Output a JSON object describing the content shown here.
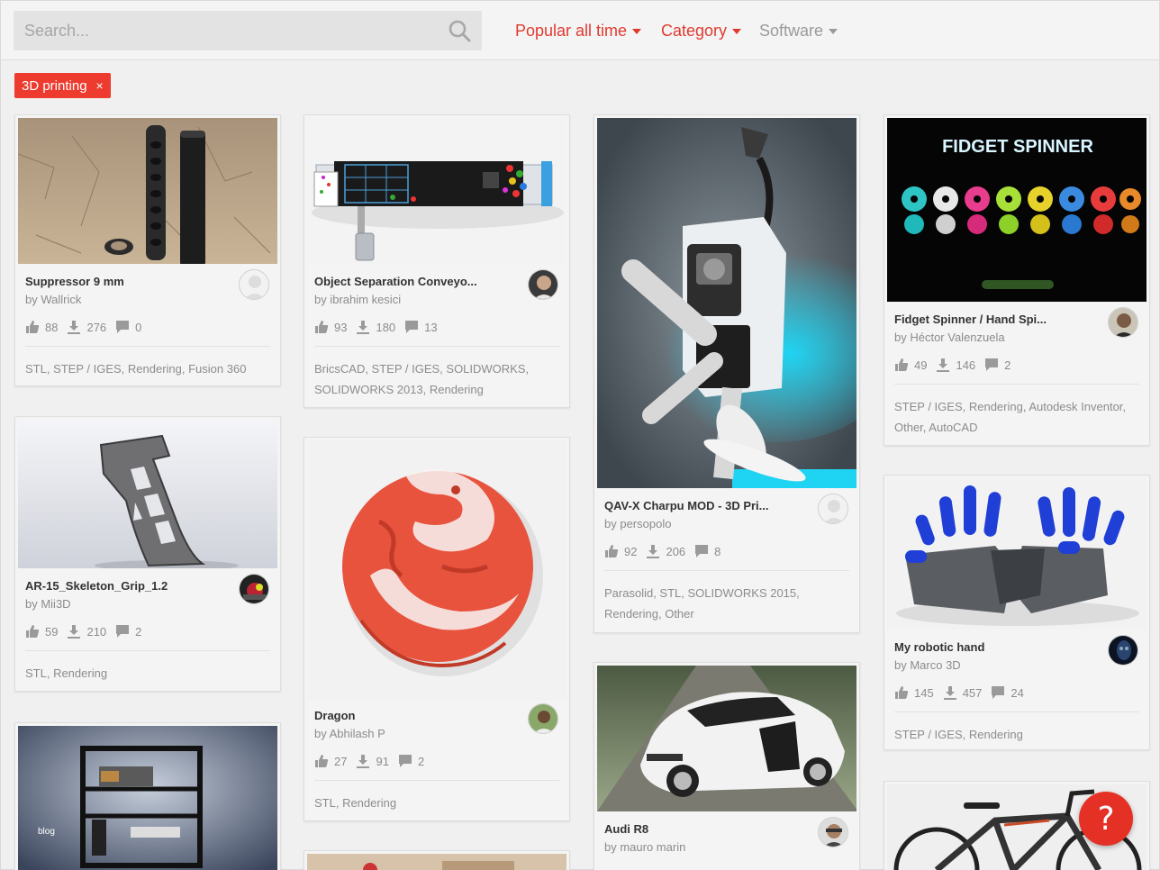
{
  "search": {
    "placeholder": "Search..."
  },
  "filters": {
    "popular": "Popular all time",
    "category": "Category",
    "software": "Software"
  },
  "active_tag": {
    "label": "3D printing",
    "remove": "×"
  },
  "help": {
    "label": "?"
  },
  "cards": [
    {
      "title": "Suppressor 9 mm",
      "author": "by Wallrick",
      "likes": "88",
      "downloads": "276",
      "comments": "0",
      "tags": "STL, STEP / IGES, Rendering, Fusion 360"
    },
    {
      "title": "AR-15_Skeleton_Grip_1.2",
      "author": "by Mii3D",
      "likes": "59",
      "downloads": "210",
      "comments": "2",
      "tags": "STL, Rendering"
    },
    {
      "title": "Object Separation Conveyo...",
      "author": "by ibrahim kesici",
      "likes": "93",
      "downloads": "180",
      "comments": "13",
      "tags": "BricsCAD, STEP / IGES, SOLIDWORKS, SOLIDWORKS 2013, Rendering"
    },
    {
      "title": "Dragon",
      "author": "by Abhilash P",
      "likes": "27",
      "downloads": "91",
      "comments": "2",
      "tags": "STL, Rendering"
    },
    {
      "title": "QAV-X Charpu MOD - 3D Pri...",
      "author": "by persopolo",
      "likes": "92",
      "downloads": "206",
      "comments": "8",
      "tags": "Parasolid, STL, SOLIDWORKS 2015, Rendering, Other"
    },
    {
      "title": "Audi R8",
      "author": "by mauro marin"
    },
    {
      "title": "Fidget Spinner / Hand Spi...",
      "author": "by Héctor Valenzuela",
      "likes": "49",
      "downloads": "146",
      "comments": "2",
      "tags": "STEP / IGES, Rendering, Autodesk Inventor, Other, AutoCAD"
    },
    {
      "title": "My robotic hand",
      "author": "by Marco 3D",
      "likes": "145",
      "downloads": "457",
      "comments": "24",
      "tags": "STEP / IGES, Rendering"
    }
  ],
  "image_text": {
    "fidget": "FIDGET SPINNER",
    "printer": "blog"
  },
  "colors": {
    "accent": "#e03a2f",
    "tag_bg": "#ed3b2f"
  }
}
